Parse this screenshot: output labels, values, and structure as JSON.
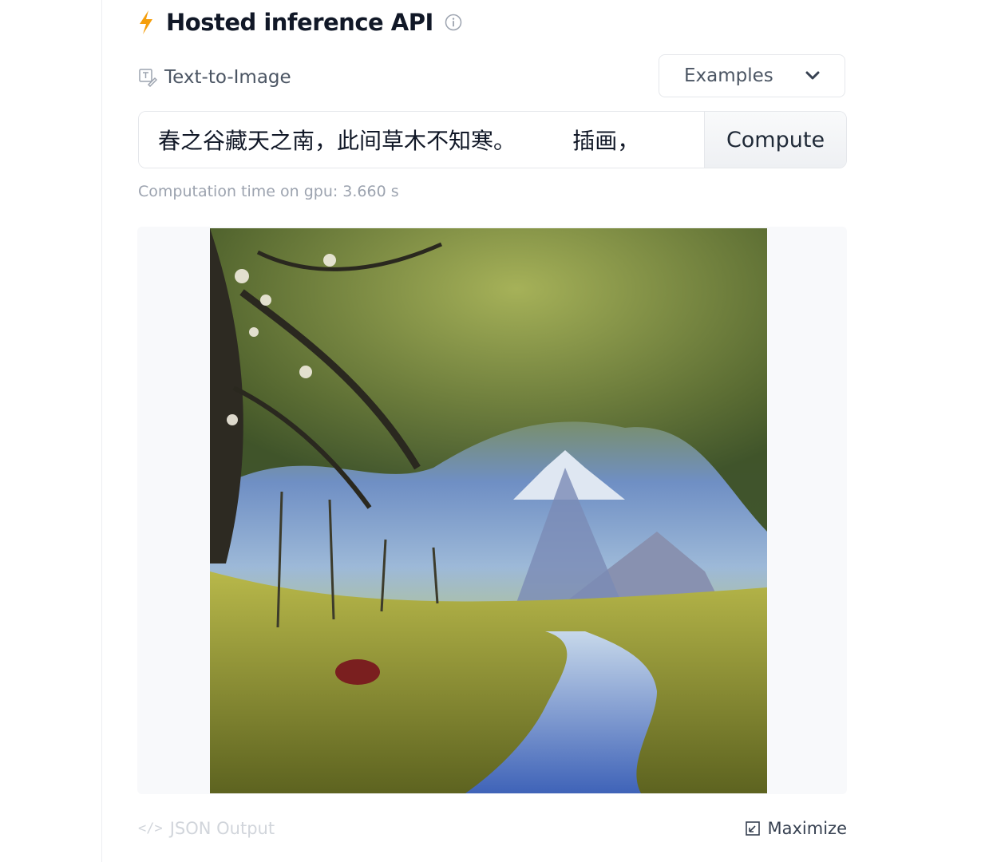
{
  "header": {
    "title": "Hosted inference API",
    "icon": "lightning-icon",
    "info_icon": "info-icon"
  },
  "task": {
    "label": "Text-to-Image",
    "icon": "text-to-image-icon"
  },
  "examples": {
    "label": "Examples",
    "icon": "chevron-down-icon"
  },
  "prompt": {
    "value": "春之谷藏天之南，此间草木不知寒。        插画，"
  },
  "compute": {
    "label": "Compute"
  },
  "timing": {
    "text": "Computation time on gpu: 3.660 s"
  },
  "output": {
    "image": "generated-landscape-image"
  },
  "footer": {
    "json_label": "JSON Output",
    "json_icon": "code-icon",
    "maximize_label": "Maximize",
    "maximize_icon": "maximize-icon"
  },
  "colors": {
    "accent": "#f59e0b",
    "text": "#111827",
    "muted": "#9ca3af"
  }
}
